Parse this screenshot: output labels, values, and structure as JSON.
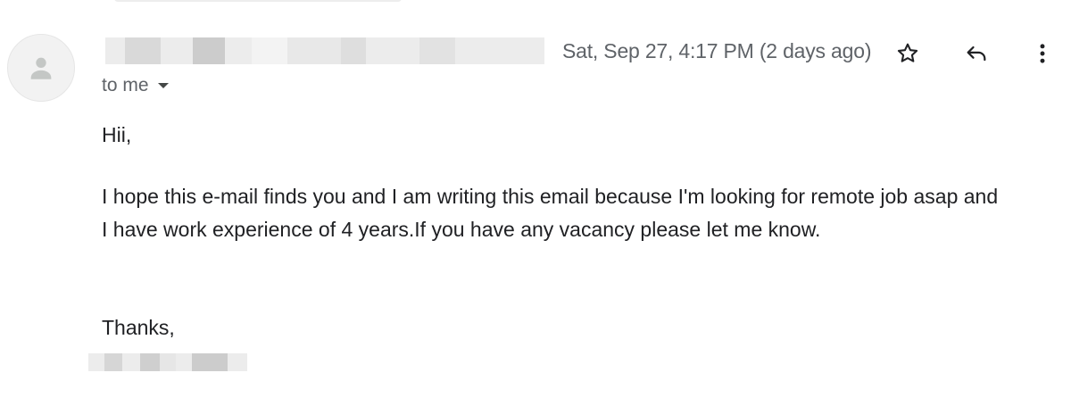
{
  "message": {
    "date": "Sat, Sep 27, 4:17 PM (2 days ago)",
    "recipient": "to me",
    "greeting": "Hii,",
    "paragraph_line_1": "I hope this e-mail finds you and I am writing this email because I'm looking for remote job asap and",
    "paragraph_line_2": "I have work experience of 4 years.If you have any vacancy please let me know.",
    "closing": "Thanks,"
  },
  "icons": {
    "avatar": "person-icon",
    "star": "star-icon",
    "reply": "reply-icon",
    "more": "more-vert-icon",
    "recipient_dropdown": "caret-down-icon"
  },
  "colors": {
    "text_primary": "#202124",
    "text_secondary": "#5f6368",
    "avatar_bg": "#f2f2f2",
    "avatar_glyph": "#c4c7c5",
    "redaction_light": "#ececec",
    "redaction_dark": "#cfcfcf"
  }
}
